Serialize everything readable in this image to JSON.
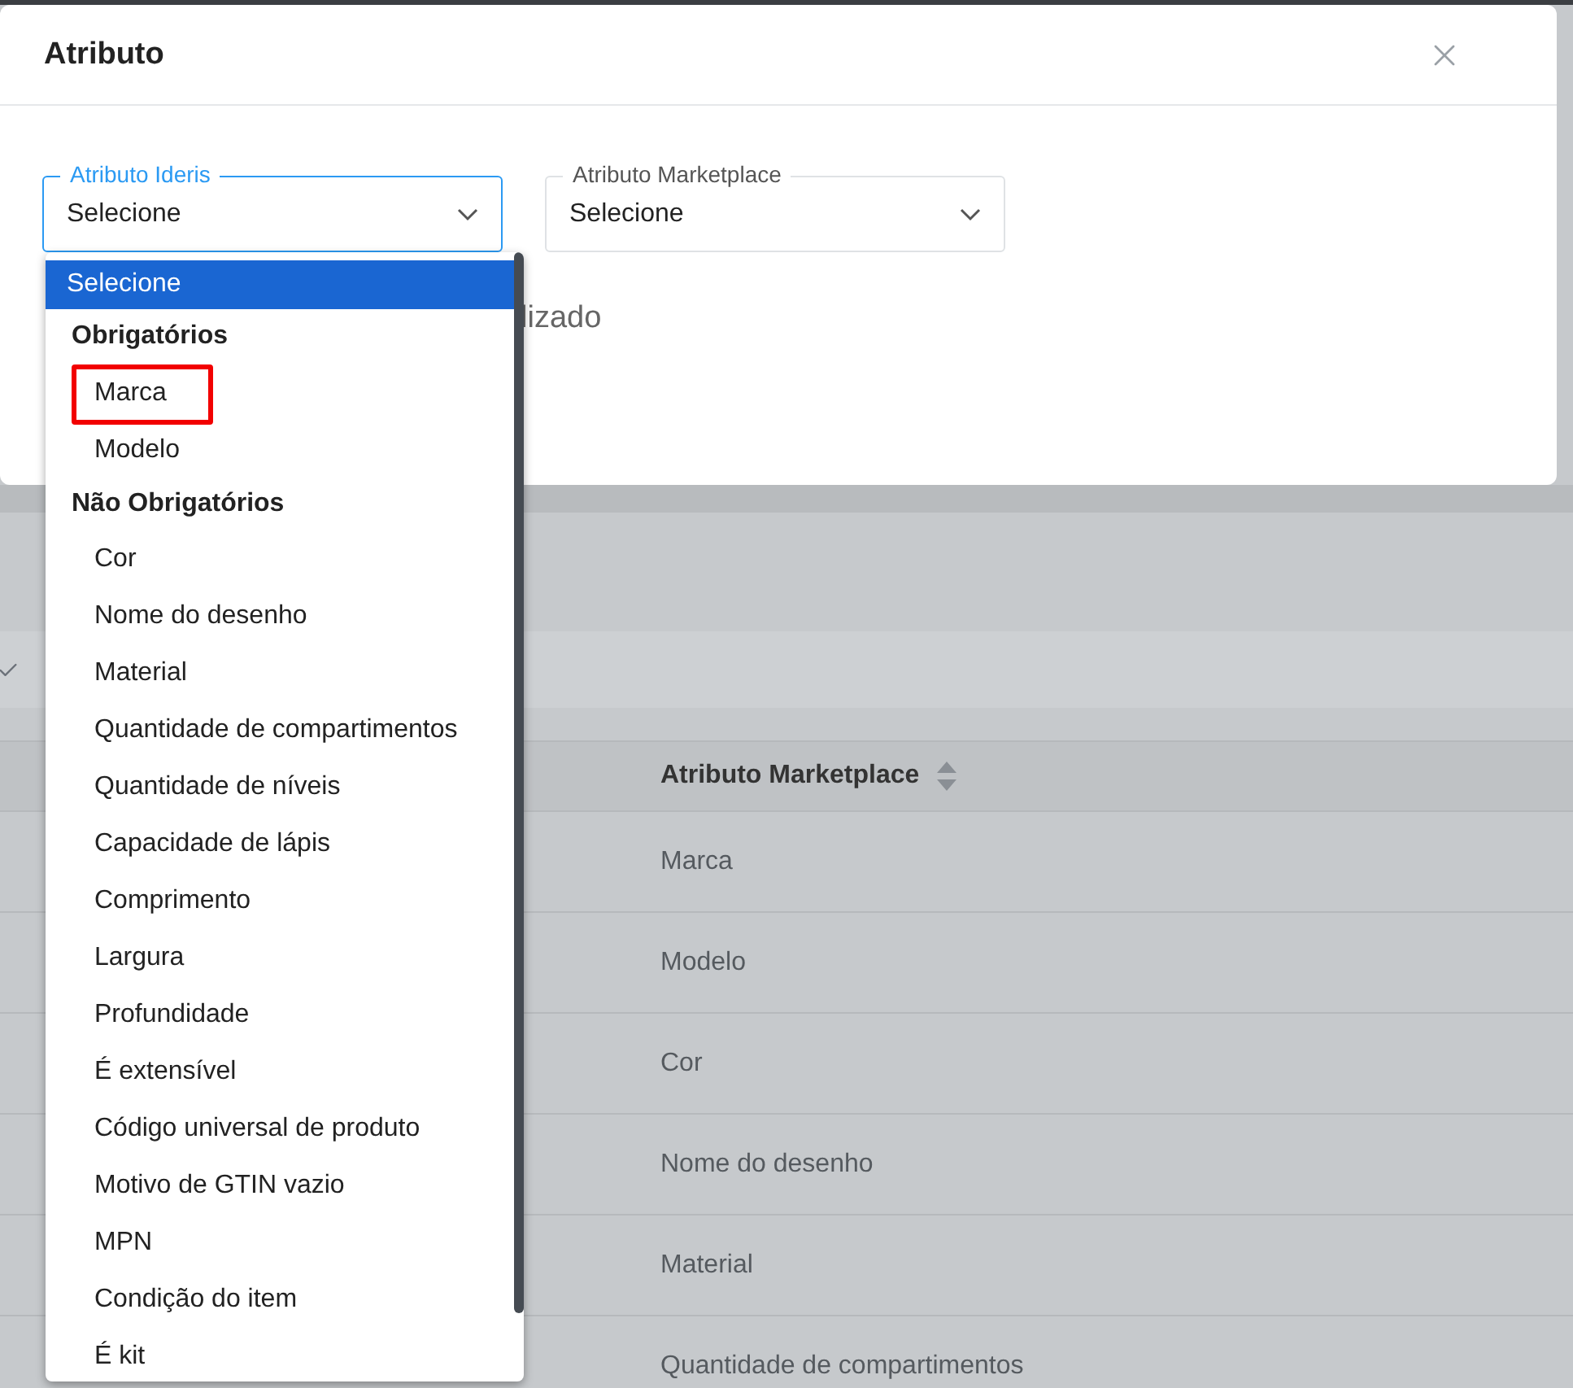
{
  "modal": {
    "title": "Atributo",
    "fields": [
      {
        "label": "Atributo Ideris",
        "value": "Selecione",
        "focused": true
      },
      {
        "label": "Atributo Marketplace",
        "value": "Selecione",
        "focused": false
      }
    ],
    "partial_text": "lizado"
  },
  "dropdown": {
    "options": [
      {
        "kind": "option",
        "label": "Selecione",
        "selected": true,
        "highlighted": false
      },
      {
        "kind": "group",
        "label": "Obrigatórios"
      },
      {
        "kind": "option",
        "label": "Marca",
        "selected": false,
        "highlighted": true
      },
      {
        "kind": "option",
        "label": "Modelo",
        "selected": false,
        "highlighted": false
      },
      {
        "kind": "group",
        "label": "Não Obrigatórios"
      },
      {
        "kind": "option",
        "label": "Cor",
        "selected": false,
        "highlighted": false
      },
      {
        "kind": "option",
        "label": "Nome do desenho",
        "selected": false,
        "highlighted": false
      },
      {
        "kind": "option",
        "label": "Material",
        "selected": false,
        "highlighted": false
      },
      {
        "kind": "option",
        "label": "Quantidade de compartimentos",
        "selected": false,
        "highlighted": false
      },
      {
        "kind": "option",
        "label": "Quantidade de níveis",
        "selected": false,
        "highlighted": false
      },
      {
        "kind": "option",
        "label": "Capacidade de lápis",
        "selected": false,
        "highlighted": false
      },
      {
        "kind": "option",
        "label": "Comprimento",
        "selected": false,
        "highlighted": false
      },
      {
        "kind": "option",
        "label": "Largura",
        "selected": false,
        "highlighted": false
      },
      {
        "kind": "option",
        "label": "Profundidade",
        "selected": false,
        "highlighted": false
      },
      {
        "kind": "option",
        "label": "É extensível",
        "selected": false,
        "highlighted": false
      },
      {
        "kind": "option",
        "label": "Código universal de produto",
        "selected": false,
        "highlighted": false
      },
      {
        "kind": "option",
        "label": "Motivo de GTIN vazio",
        "selected": false,
        "highlighted": false
      },
      {
        "kind": "option",
        "label": "MPN",
        "selected": false,
        "highlighted": false
      },
      {
        "kind": "option",
        "label": "Condição do item",
        "selected": false,
        "highlighted": false
      },
      {
        "kind": "option",
        "label": "É kit",
        "selected": false,
        "highlighted": false
      }
    ]
  },
  "table": {
    "columns": [
      "Atributo Marketplace"
    ],
    "rows": [
      "Marca",
      "Modelo",
      "Cor",
      "Nome do desenho",
      "Material",
      "Quantidade de compartimentos"
    ]
  }
}
